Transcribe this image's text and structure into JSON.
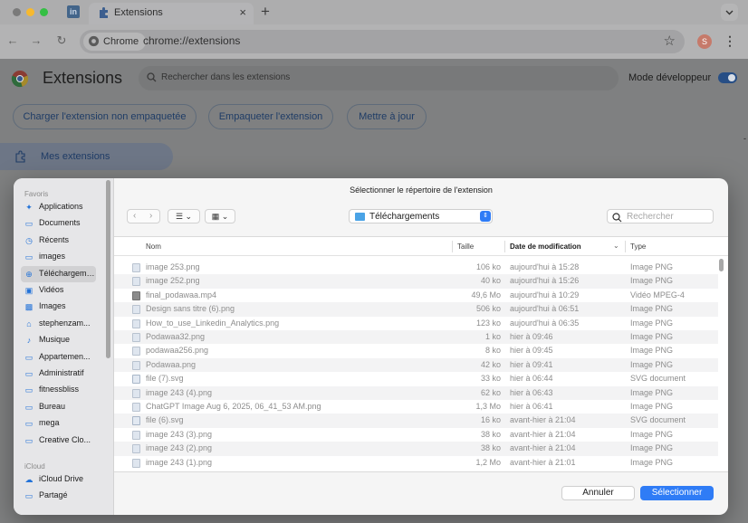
{
  "browser": {
    "tab_title": "Extensions",
    "new_tab_glyph": "+",
    "site_chip": "Chrome",
    "url": "chrome://extensions",
    "profile_initial": "S",
    "accent_color": "#2f7cf6"
  },
  "extensions_page": {
    "title": "Extensions",
    "search_placeholder": "Rechercher dans les extensions",
    "dev_mode_label": "Mode développeur",
    "dev_mode_on": true,
    "buttons": {
      "load_unpacked": "Charger l'extension non empaquetée",
      "pack": "Empaqueter l'extension",
      "update": "Mettre à jour"
    },
    "my_extensions": "Mes extensions"
  },
  "dialog": {
    "title": "Sélectionner le répertoire de l'extension",
    "location": "Téléchargements",
    "search_placeholder": "Rechercher",
    "sidebar": {
      "favorites_header": "Favoris",
      "favorites": [
        {
          "label": "Applications",
          "icon": "applications-icon"
        },
        {
          "label": "Documents",
          "icon": "document-icon"
        },
        {
          "label": "Récents",
          "icon": "clock-icon"
        },
        {
          "label": "images",
          "icon": "folder-icon"
        },
        {
          "label": "Téléchargements",
          "icon": "download-icon"
        },
        {
          "label": "Vidéos",
          "icon": "video-icon"
        },
        {
          "label": "Images",
          "icon": "photo-icon"
        },
        {
          "label": "stephenzam...",
          "icon": "home-icon"
        },
        {
          "label": "Musique",
          "icon": "music-icon"
        },
        {
          "label": "Appartemen...",
          "icon": "folder-icon"
        },
        {
          "label": "Administratif",
          "icon": "folder-icon"
        },
        {
          "label": "fitnessbliss",
          "icon": "folder-icon"
        },
        {
          "label": "Bureau",
          "icon": "desktop-icon"
        },
        {
          "label": "mega",
          "icon": "folder-icon"
        },
        {
          "label": "Creative Clo...",
          "icon": "folder-icon"
        }
      ],
      "icloud_header": "iCloud",
      "icloud": [
        {
          "label": "iCloud Drive",
          "icon": "cloud-icon"
        },
        {
          "label": "Partagé",
          "icon": "shared-folder-icon"
        }
      ]
    },
    "columns": {
      "name": "Nom",
      "size": "Taille",
      "date": "Date de modification",
      "kind": "Type"
    },
    "files": [
      {
        "name": "image 253.png",
        "size": "106 ko",
        "date": "aujourd'hui à 15:28",
        "kind": "Image PNG",
        "icon": "image"
      },
      {
        "name": "image 252.png",
        "size": "40 ko",
        "date": "aujourd'hui à 15:26",
        "kind": "Image PNG",
        "icon": "image"
      },
      {
        "name": "final_podawaa.mp4",
        "size": "49,6 Mo",
        "date": "aujourd'hui à 10:29",
        "kind": "Vidéo MPEG-4",
        "icon": "video"
      },
      {
        "name": "Design sans titre (6).png",
        "size": "506 ko",
        "date": "aujourd'hui à 06:51",
        "kind": "Image PNG",
        "icon": "image"
      },
      {
        "name": "How_to_use_Linkedin_Analytics.png",
        "size": "123 ko",
        "date": "aujourd'hui à 06:35",
        "kind": "Image PNG",
        "icon": "image"
      },
      {
        "name": "Podawaa32.png",
        "size": "1 ko",
        "date": "hier à 09:46",
        "kind": "Image PNG",
        "icon": "image"
      },
      {
        "name": "podawaa256.png",
        "size": "8 ko",
        "date": "hier à 09:45",
        "kind": "Image PNG",
        "icon": "image"
      },
      {
        "name": "Podawaa.png",
        "size": "42 ko",
        "date": "hier à 09:41",
        "kind": "Image PNG",
        "icon": "image"
      },
      {
        "name": "file (7).svg",
        "size": "33 ko",
        "date": "hier à 06:44",
        "kind": "SVG document",
        "icon": "svg"
      },
      {
        "name": "image 243 (4).png",
        "size": "62 ko",
        "date": "hier à 06:43",
        "kind": "Image PNG",
        "icon": "image"
      },
      {
        "name": "ChatGPT Image Aug 6, 2025, 06_41_53 AM.png",
        "size": "1,3 Mo",
        "date": "hier à 06:41",
        "kind": "Image PNG",
        "icon": "image"
      },
      {
        "name": "file (6).svg",
        "size": "16 ko",
        "date": "avant-hier à 21:04",
        "kind": "SVG document",
        "icon": "svg"
      },
      {
        "name": "image 243 (3).png",
        "size": "38 ko",
        "date": "avant-hier à 21:04",
        "kind": "Image PNG",
        "icon": "image"
      },
      {
        "name": "image 243 (2).png",
        "size": "38 ko",
        "date": "avant-hier à 21:04",
        "kind": "Image PNG",
        "icon": "image"
      },
      {
        "name": "image 243 (1).png",
        "size": "1,2 Mo",
        "date": "avant-hier à 21:01",
        "kind": "Image PNG",
        "icon": "image"
      }
    ],
    "cancel_label": "Annuler",
    "select_label": "Sélectionner"
  }
}
